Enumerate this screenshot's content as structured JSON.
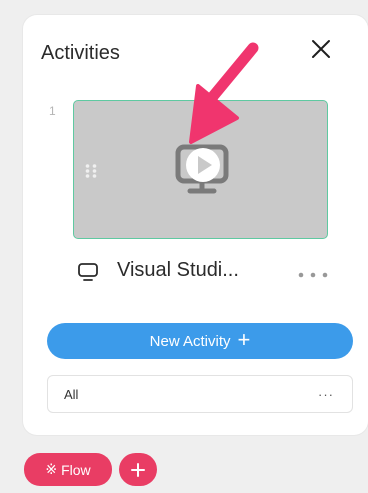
{
  "panel": {
    "title": "Activities",
    "close_icon": "close-icon"
  },
  "activities": [
    {
      "number": "1",
      "name": "Visual Studi...",
      "icon": "monitor-icon",
      "thumbnail_icon": "monitor-play-icon",
      "more_icon": "ellipsis-icon"
    }
  ],
  "actions": {
    "new_activity_label": "New Activity",
    "new_activity_icon": "+"
  },
  "filter": {
    "selected": "All",
    "more": "···"
  },
  "bottom": {
    "flow_label": "Flow",
    "flow_icon": "※",
    "add_icon": "plus-icon"
  },
  "colors": {
    "accent_blue": "#3c9bea",
    "accent_pink": "#e93d64",
    "thumbnail_border": "#5fc9a1",
    "thumbnail_bg": "#c9c9c9"
  }
}
